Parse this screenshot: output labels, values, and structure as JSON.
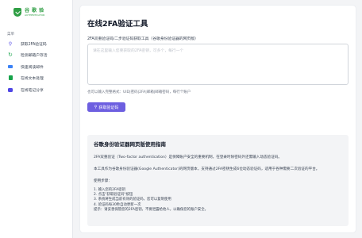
{
  "brand": {
    "name": "谷 歌 验",
    "subtitle": "AUTHENTICATOR",
    "color": "#2f9e44"
  },
  "sidebar": {
    "menu_title": "菜单",
    "items": [
      {
        "label": "获取2FA验证码",
        "icon": "key-icon"
      },
      {
        "label": "检测邮箱户存活",
        "icon": "sync-icon"
      },
      {
        "label": "快速阅读邮件",
        "icon": "mail-icon"
      },
      {
        "label": "在线文本处理",
        "icon": "document-icon"
      },
      {
        "label": "在线笔记分享",
        "icon": "chat-icon"
      }
    ]
  },
  "main": {
    "title": "在线2FA验证工具",
    "field_label": "2FA双重验证码/二步验证码获取工具（谷歌身份验证器的网页版）",
    "input_placeholder": "请在这里输入您要获取的2FA密钥，可多个，每行一个",
    "input_value": "",
    "hint": "也可以输入完整格式：UID|密码|2FA|邮箱|邮箱密码，每行个账户",
    "button_label": "获取验证码",
    "button_color": "#6d5fe0"
  },
  "guide": {
    "title": "谷歌身份验证器网页版使用指南",
    "paragraph1": "2FA双重验证（Two-factor authentication）是保障账户安全的重要机制，在登录时除密码外还需输入动态验证码。",
    "paragraph2": "本工具作为谷歌身份验证器(Google Authenticator)的网页版本，支持通过2FA密钥生成6位动态验证码，适用于各种需要二次验证的平台。",
    "steps_title": "使用步骤：",
    "steps": [
      "1. 输入您的2FA密钥",
      "2. 点击\"获取验证码\"按钮",
      "3. 系统将生成当前有效的验证码，您可以复制使用",
      "4. 验证码每30秒自动更新一次"
    ],
    "tip": "提示：请妥善保管您的2FA密钥，不要泄露给他人，以确保您的账户安全。"
  }
}
